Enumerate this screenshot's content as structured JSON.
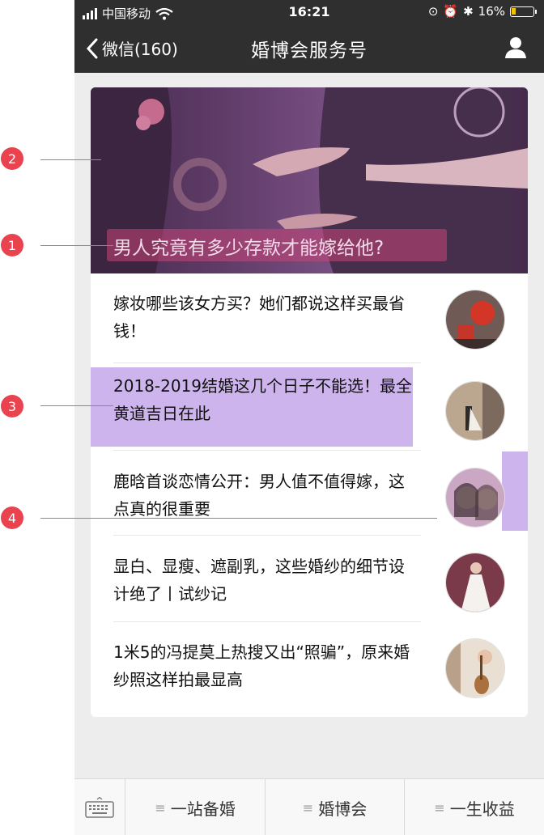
{
  "status_bar": {
    "carrier": "中国移动",
    "time": "16:21",
    "battery": "16%"
  },
  "nav": {
    "back_label": "微信(160)",
    "title": "婚博会服务号"
  },
  "hero": {
    "title": "男人究竟有多少存款才能嫁给他?"
  },
  "articles": [
    {
      "title": "嫁妆哪些该女方买？她们都说这样买最省钱！"
    },
    {
      "title": "2018-2019结婚这几个日子不能选！最全黄道吉日在此"
    },
    {
      "title": "鹿晗首谈恋情公开：男人值不值得嫁，这点真的很重要"
    },
    {
      "title": "显白、显瘦、遮副乳，这些婚纱的细节设计绝了丨试纱记"
    },
    {
      "title": "1米5的冯提莫上热搜又出“照骗”，原来婚纱照这样拍最显高"
    }
  ],
  "tabbar": {
    "tabs": [
      "一站备婚",
      "婚博会",
      "一生收益"
    ]
  },
  "annotations": {
    "markers": [
      "1",
      "2",
      "3",
      "4"
    ]
  },
  "colors": {
    "nav_bg": "#2f2f2f",
    "highlight": "#cdb4ec",
    "marker": "#e8434e"
  }
}
